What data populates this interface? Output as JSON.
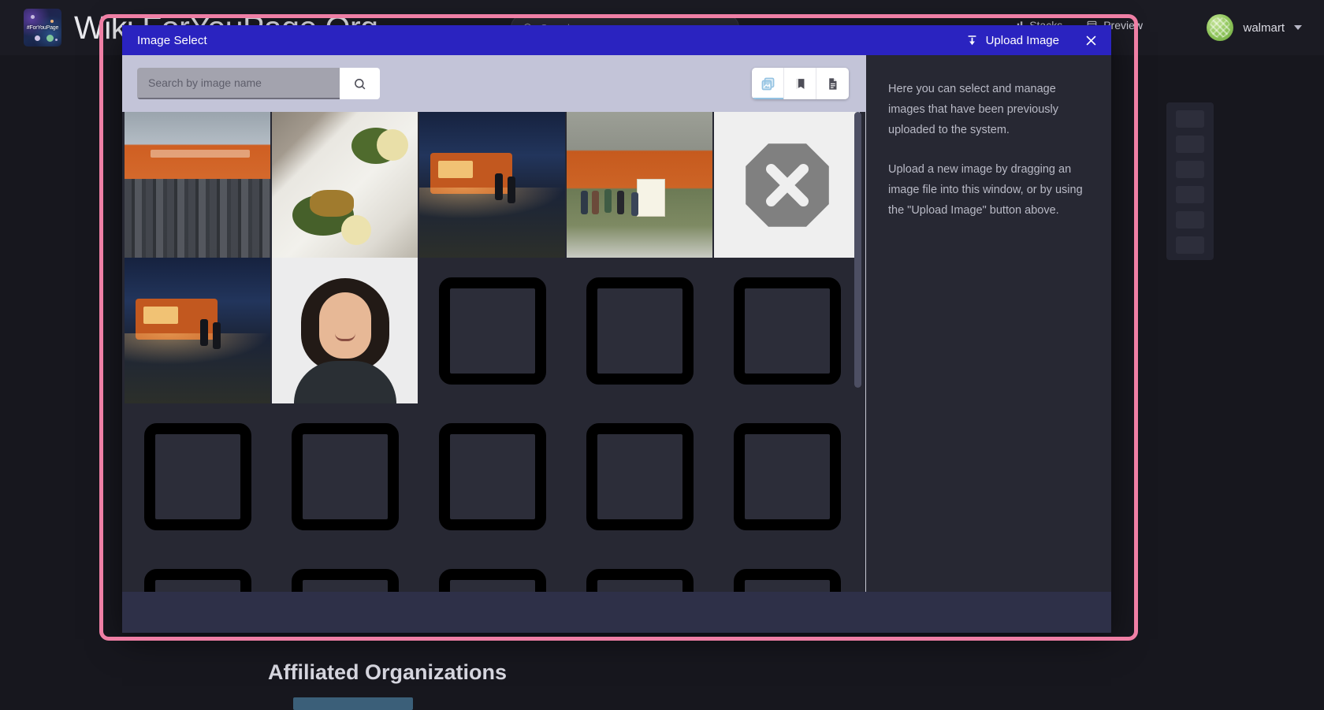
{
  "site": {
    "logo_tag": "#ForYouPage",
    "title": "Wiki.ForYouPage.Org",
    "search_placeholder": "Search",
    "nav": [
      {
        "label": "Stacks",
        "icon": "stacks-icon"
      },
      {
        "label": "Preview",
        "icon": "preview-icon"
      }
    ],
    "user": {
      "name": "walmart",
      "caret": "chevron-down-icon"
    },
    "section_heading": "Affiliated Organizations"
  },
  "modal": {
    "title": "Image Select",
    "upload_label": "Upload Image",
    "upload_icon": "upload-icon",
    "close_icon": "close-icon",
    "search": {
      "value": "",
      "placeholder": "Search by image name",
      "button_icon": "search-icon"
    },
    "view_toggle": [
      {
        "name": "image-gallery-view",
        "icon": "images-icon",
        "active": true
      },
      {
        "name": "book-view",
        "icon": "book-icon",
        "active": false
      },
      {
        "name": "document-view",
        "icon": "document-icon",
        "active": false
      }
    ],
    "info": {
      "paragraph_1": "Here you can select and manage images that have been previously uploaded to the system.",
      "paragraph_2": "Upload a new image by dragging an image file into this window, or by using the \"Upload Image\" button above."
    },
    "gallery": {
      "items": [
        {
          "kind": "photo",
          "render": "ph-group",
          "alt": "Group of volunteers outside Meals On Main Express food truck"
        },
        {
          "kind": "photo",
          "render": "ph-food",
          "alt": "Two takeout containers with chicken, greens and mashed potatoes"
        },
        {
          "kind": "photo",
          "render": "ph-night",
          "alt": "Food truck serving at dusk"
        },
        {
          "kind": "photo",
          "render": "ph-line",
          "alt": "People lined up by an orange food truck with a sign"
        },
        {
          "kind": "broken",
          "render": "ph-broken",
          "alt": "Missing image placeholder"
        },
        {
          "kind": "photo",
          "render": "ph-night",
          "alt": "Food truck serving at night"
        },
        {
          "kind": "photo",
          "render": "ph-portrait",
          "alt": "Portrait headshot of a smiling person"
        },
        {
          "kind": "skeleton"
        },
        {
          "kind": "skeleton"
        },
        {
          "kind": "skeleton"
        },
        {
          "kind": "skeleton"
        },
        {
          "kind": "skeleton"
        },
        {
          "kind": "skeleton"
        },
        {
          "kind": "skeleton"
        },
        {
          "kind": "skeleton"
        },
        {
          "kind": "skeleton"
        },
        {
          "kind": "skeleton"
        },
        {
          "kind": "skeleton"
        },
        {
          "kind": "skeleton"
        },
        {
          "kind": "skeleton"
        }
      ]
    }
  },
  "colors": {
    "modal_title_bar": "#2a23c0",
    "modal_body": "#272833",
    "modal_footer": "#2e3048",
    "search_row": "#c3c4d8",
    "highlight_frame": "#ef7fa5",
    "accent_active": "#93c2e2"
  }
}
